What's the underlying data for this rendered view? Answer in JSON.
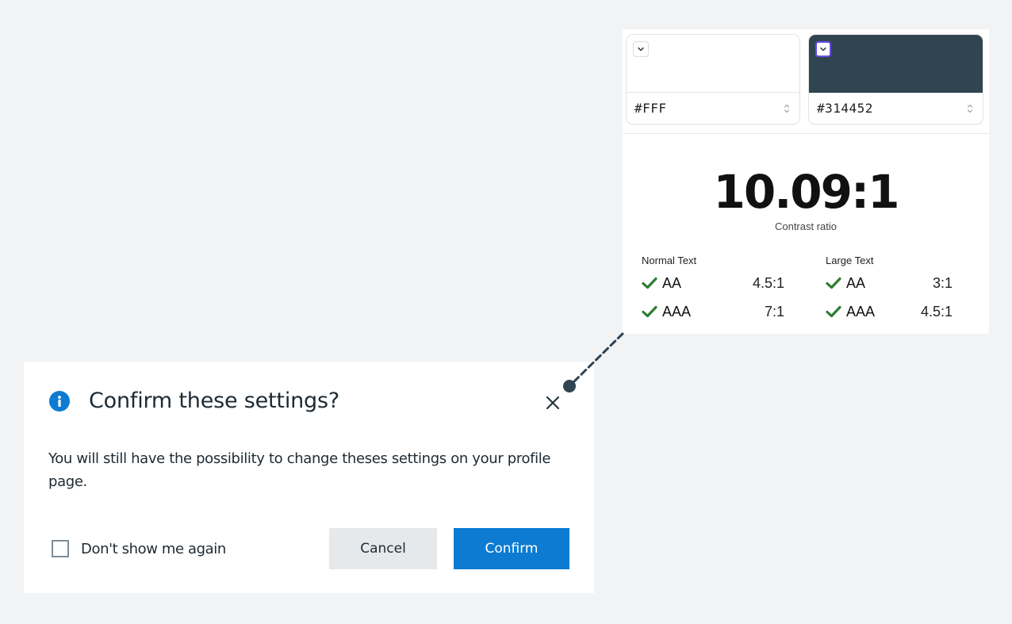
{
  "contrast_checker": {
    "foreground": {
      "color": "#FFFFFF",
      "value": "#FFF",
      "toggle_icon": "chevron-down-icon",
      "stepper_icon": "up-down-chevron-icon"
    },
    "background": {
      "color": "#314452",
      "value": "#314452",
      "toggle_icon": "chevron-down-icon",
      "stepper_icon": "up-down-chevron-icon"
    },
    "ratio": "10.09:1",
    "ratio_label": "Contrast ratio",
    "normal_text": {
      "title": "Normal Text",
      "levels": [
        {
          "name": "AA",
          "threshold": "4.5:1",
          "pass": true
        },
        {
          "name": "AAA",
          "threshold": "7:1",
          "pass": true
        }
      ]
    },
    "large_text": {
      "title": "Large Text",
      "levels": [
        {
          "name": "AA",
          "threshold": "3:1",
          "pass": true
        },
        {
          "name": "AAA",
          "threshold": "4.5:1",
          "pass": true
        }
      ]
    },
    "pass_color": "#2e7d32"
  },
  "dialog": {
    "icon": "info-icon",
    "title": "Confirm these settings?",
    "close_icon": "close-icon",
    "body": "You will still have the possibility to change theses settings on your profile page.",
    "checkbox_label": "Don't show me again",
    "checkbox_checked": false,
    "cancel_label": "Cancel",
    "confirm_label": "Confirm",
    "accent_color": "#0C7BD1"
  },
  "annotation": {
    "connector_color": "#314452"
  }
}
